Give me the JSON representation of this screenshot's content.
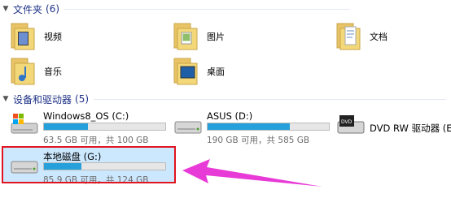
{
  "folders_group": {
    "title": "文件夹",
    "count": "(6)"
  },
  "folders": [
    {
      "label": "视频"
    },
    {
      "label": "图片"
    },
    {
      "label": "文档"
    },
    {
      "label": "音乐"
    },
    {
      "label": "桌面"
    }
  ],
  "drives_group": {
    "title": "设备和驱动器",
    "count": "(5)"
  },
  "drives": [
    {
      "name": "Windows8_OS (C:)",
      "space": "63.5 GB 可用，共 100 GB",
      "used_fraction": 0.365
    },
    {
      "name": "ASUS (D:)",
      "space": "190 GB 可用，共 585 GB",
      "used_fraction": 0.675
    },
    {
      "name": "DVD RW 驱动器 (E:)"
    },
    {
      "name": "本地磁盘 (G:)",
      "space": "85.9 GB 可用，共 124 GB",
      "used_fraction": 0.31
    }
  ],
  "colors": {
    "accent": "#26a0da",
    "highlight_border": "#e1141f",
    "arrow": "#e83ad6"
  }
}
